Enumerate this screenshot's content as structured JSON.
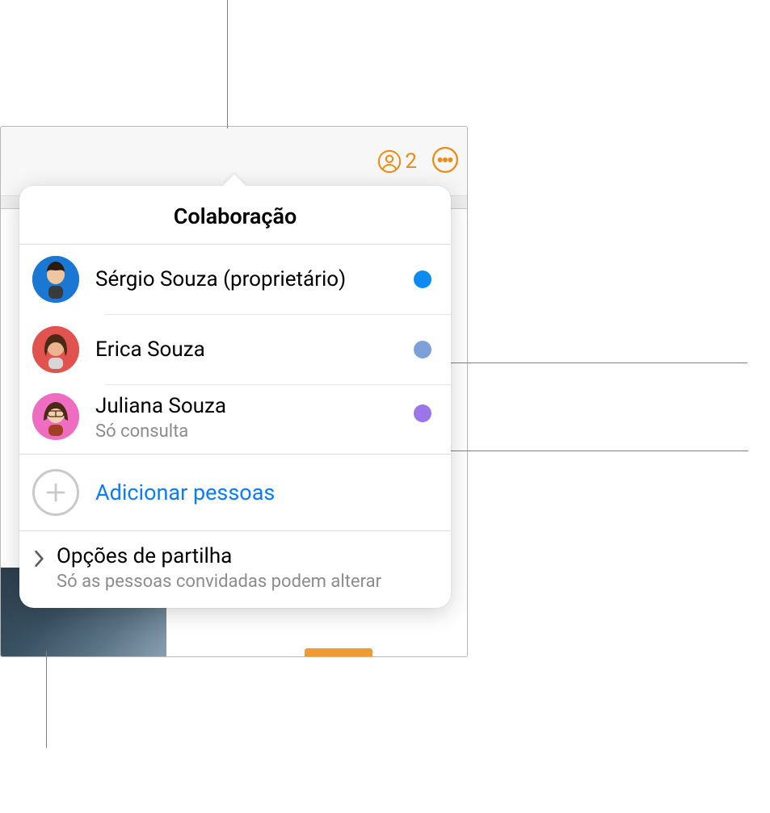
{
  "toolbar": {
    "people_count": "2"
  },
  "popover": {
    "title": "Colaboração",
    "participants": [
      {
        "name": "Sérgio Souza (proprietário)",
        "sub": "",
        "dot_color": "#0e8bf1",
        "avatar_bg": "#1a77d3"
      },
      {
        "name": "Erica Souza",
        "sub": "",
        "dot_color": "#7da0d8",
        "avatar_bg": "#e2524f"
      },
      {
        "name": "Juliana Souza",
        "sub": "Só consulta",
        "dot_color": "#9a76e9",
        "avatar_bg": "#ef6dc0"
      }
    ],
    "add_label": "Adicionar pessoas",
    "share": {
      "title": "Opções de partilha",
      "desc": "Só as pessoas convidadas podem alterar"
    }
  }
}
